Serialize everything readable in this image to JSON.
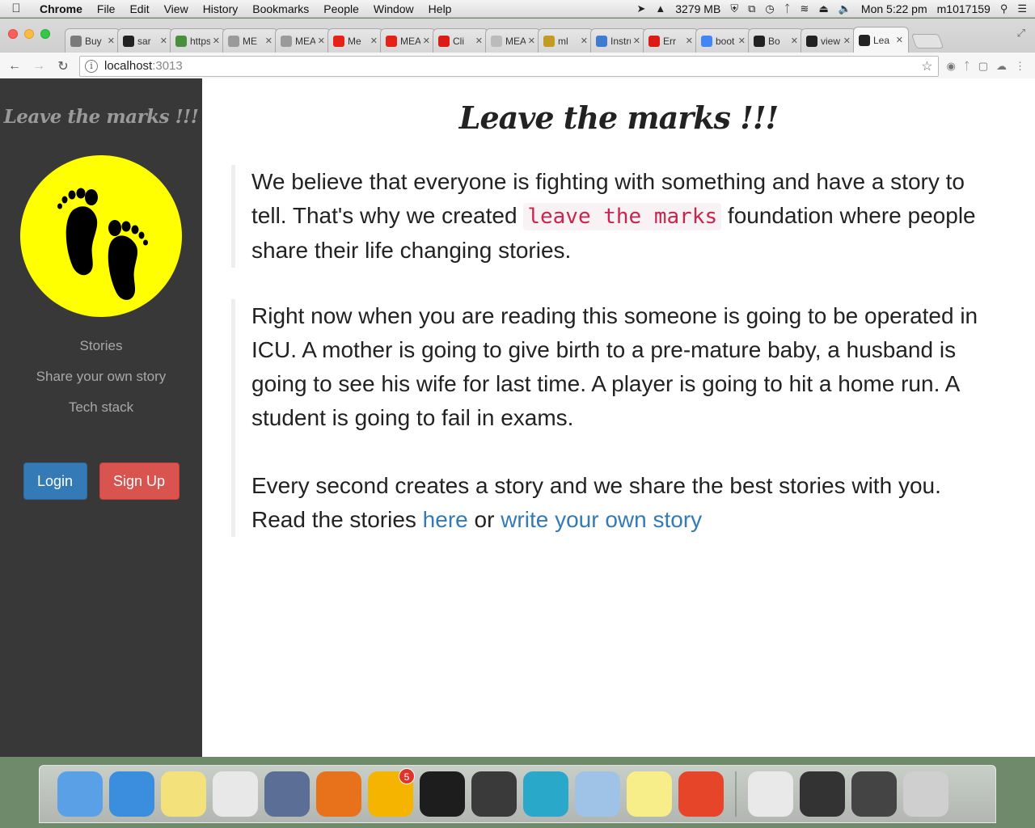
{
  "menubar": {
    "app": "Chrome",
    "items": [
      "File",
      "Edit",
      "View",
      "History",
      "Bookmarks",
      "People",
      "Window",
      "Help"
    ],
    "memory": "3279 MB",
    "clock": "Mon 5:22 pm",
    "user": "m1017159"
  },
  "browser": {
    "tabs": [
      {
        "label": "Buy E",
        "favicon_color": "#7a7a7a",
        "icon": "rt-icon"
      },
      {
        "label": "sar",
        "favicon_color": "#222222",
        "icon": "github-icon"
      },
      {
        "label": "https",
        "favicon_color": "#4a8f3c",
        "icon": "cube-icon"
      },
      {
        "label": "ME",
        "favicon_color": "#9a9a9a",
        "icon": "avatar-icon"
      },
      {
        "label": "MEAN",
        "favicon_color": "#9a9a9a",
        "icon": "avatar-icon"
      },
      {
        "label": "Me",
        "favicon_color": "#e62117",
        "icon": "youtube-icon"
      },
      {
        "label": "MEAN",
        "favicon_color": "#e62117",
        "icon": "youtube-icon"
      },
      {
        "label": "Cli",
        "favicon_color": "#dd1b16",
        "icon": "angular-icon"
      },
      {
        "label": "MEAN",
        "favicon_color": "#bbbbbb",
        "icon": "document-icon"
      },
      {
        "label": "ml",
        "favicon_color": "#c39b23",
        "icon": "bookmark-icon"
      },
      {
        "label": "Instru",
        "favicon_color": "#3e7bd1",
        "icon": "e-icon"
      },
      {
        "label": "Err",
        "favicon_color": "#dd1b16",
        "icon": "angular-icon"
      },
      {
        "label": "boot",
        "favicon_color": "#4285f4",
        "icon": "google-icon"
      },
      {
        "label": "Bo",
        "favicon_color": "#222222",
        "icon": "b-icon"
      },
      {
        "label": "view",
        "favicon_color": "#222222",
        "icon": "b-icon"
      },
      {
        "label": "Lea",
        "favicon_color": "#222222",
        "icon": "footprint-icon",
        "active": true
      }
    ],
    "url_host": "localhost",
    "url_port": ":3013"
  },
  "sidebar": {
    "brand": "Leave the marks !!!",
    "nav": [
      {
        "label": "Stories"
      },
      {
        "label": "Share your own story"
      },
      {
        "label": "Tech stack"
      }
    ],
    "login_label": "Login",
    "signup_label": "Sign Up",
    "logo_color": "#ffff00"
  },
  "content": {
    "title": "Leave the marks !!!",
    "p1_before": "We believe that everyone is fighting with something and have a story to tell. That's why we created ",
    "p1_code": "leave the marks",
    "p1_after": " foundation where people share their life changing stories.",
    "p2": "Right now when you are reading this someone is going to be operated in ICU. A mother is going to give birth to a pre-mature baby, a husband is going to see his wife for last time. A player is going to hit a home run. A student is going to fail in exams.",
    "p3": "Every second creates a story and we share the best stories with you.",
    "p4_before": "Read the stories ",
    "p4_link1": "here",
    "p4_middle": " or ",
    "p4_link2": "write your own story"
  },
  "colors": {
    "sidebar_bg": "#383838",
    "link": "#337ab7",
    "login": "#337ab7",
    "signup": "#d9534f",
    "code": "#c7254e"
  },
  "dock": {
    "apps": [
      {
        "name": "finder-icon",
        "color": "#5aa0e6"
      },
      {
        "name": "safari-icon",
        "color": "#3b8ede"
      },
      {
        "name": "notes-icon",
        "color": "#f3e27b"
      },
      {
        "name": "chrome-icon",
        "color": "#e8e8e8"
      },
      {
        "name": "vmware-icon",
        "color": "#5a6e96"
      },
      {
        "name": "firefox-icon",
        "color": "#e8721c"
      },
      {
        "name": "outlook-icon",
        "color": "#f4b400",
        "badge": "5"
      },
      {
        "name": "terminal-icon",
        "color": "#1d1d1d"
      },
      {
        "name": "sublime-icon",
        "color": "#3a3a3a"
      },
      {
        "name": "lync-icon",
        "color": "#2aa8c9"
      },
      {
        "name": "virtualbox-icon",
        "color": "#9ec3e6"
      },
      {
        "name": "stickies-icon",
        "color": "#f7ee8a"
      },
      {
        "name": "paw-icon",
        "color": "#e6452a"
      },
      {
        "name": "preview-icon",
        "color": "#e9e9e9"
      },
      {
        "name": "terminal-window-icon",
        "color": "#333333"
      },
      {
        "name": "sublime-window-icon",
        "color": "#444444"
      },
      {
        "name": "trash-icon",
        "color": "#cfcfcf"
      }
    ]
  }
}
